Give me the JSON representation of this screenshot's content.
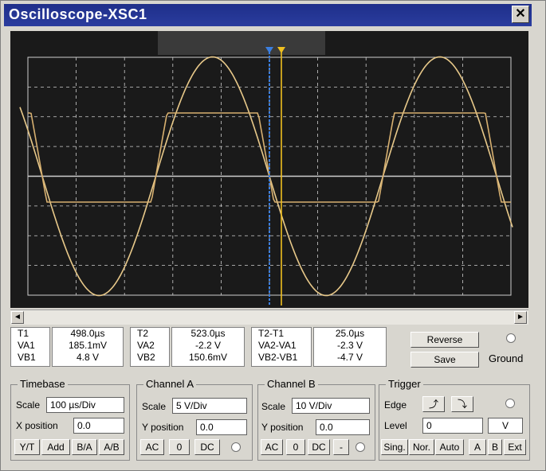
{
  "window": {
    "title": "Oscilloscope-XSC1",
    "close_glyph": "✕"
  },
  "scroll": {
    "left": "◄",
    "right": "►"
  },
  "readout": {
    "t1": {
      "label": "T1",
      "time": "498.0µs"
    },
    "t2": {
      "label": "T2",
      "time": "523.0µs"
    },
    "diff": {
      "label": "T2-T1",
      "time": "25.0µs"
    },
    "row_a": {
      "t1_label": "VA1",
      "t1_val": "185.1mV",
      "t2_label": "VA2",
      "t2_val": "-2.2 V",
      "diff_label": "VA2-VA1",
      "diff_val": "-2.3 V"
    },
    "row_b": {
      "t1_label": "VB1",
      "t1_val": "4.8 V",
      "t2_label": "VB2",
      "t2_val": "150.6mV",
      "diff_label": "VB2-VB1",
      "diff_val": "-4.7 V"
    }
  },
  "buttons": {
    "reverse": "Reverse",
    "save": "Save",
    "ground": "Ground"
  },
  "timebase": {
    "title": "Timebase",
    "scale_label": "Scale",
    "scale_value": "100 µs/Div",
    "xpos_label": "X position",
    "xpos_value": "0.0",
    "modes": [
      "Y/T",
      "Add",
      "B/A",
      "A/B"
    ]
  },
  "channel_a": {
    "title": "Channel A",
    "scale_label": "Scale",
    "scale_value": "5 V/Div",
    "ypos_label": "Y position",
    "ypos_value": "0.0",
    "coupling": [
      "AC",
      "0",
      "DC"
    ]
  },
  "channel_b": {
    "title": "Channel B",
    "scale_label": "Scale",
    "scale_value": "10 V/Div",
    "ypos_label": "Y position",
    "ypos_value": "0.0",
    "coupling": [
      "AC",
      "0",
      "DC",
      "-"
    ]
  },
  "trigger": {
    "title": "Trigger",
    "edge_label": "Edge",
    "level_label": "Level",
    "level_value": "0",
    "level_unit": "V",
    "rising": "⤴",
    "falling": "⤵",
    "modes": [
      "Sing.",
      "Nor.",
      "Auto"
    ],
    "sources": [
      "A",
      "B",
      "Ext"
    ]
  },
  "colors": {
    "trace_a": "#e8c98a",
    "trace_b": "#d7b070",
    "cursor1": "#3b7fe0",
    "cursor2": "#f0c020",
    "grid": "#cfcfcf",
    "screen": "#1a1a1a"
  }
}
